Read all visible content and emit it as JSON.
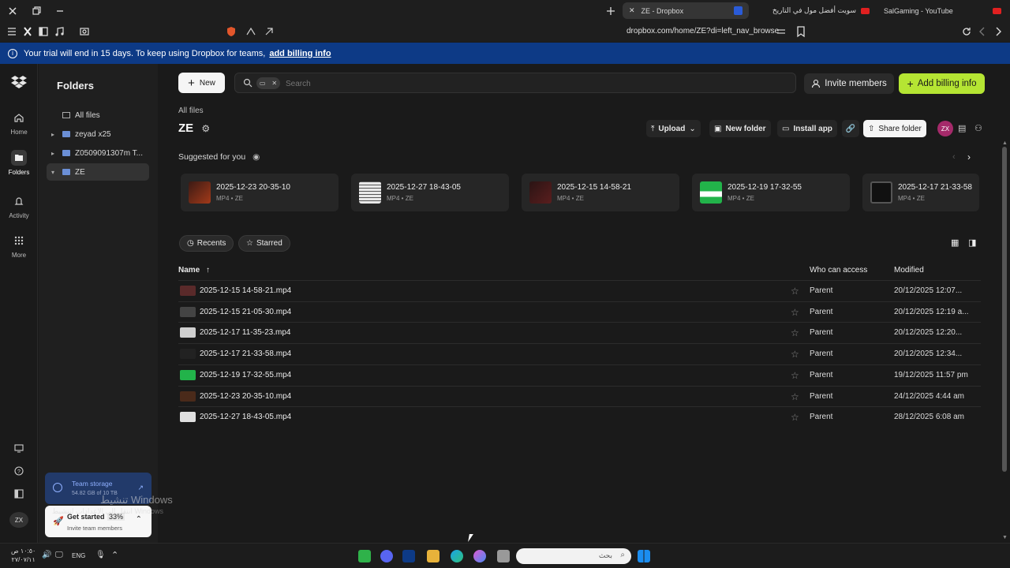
{
  "browser": {
    "tabs": [
      {
        "label": "ZE - Dropbox",
        "active": true
      },
      {
        "label": "سويت أفضل مول في التاريخ",
        "active": false
      },
      {
        "label": "SalGaming - YouTube",
        "active": false
      }
    ],
    "url": "dropbox.com/home/ZE?di=left_nav_browse"
  },
  "banner": {
    "text": "Your trial will end in 15 days. To keep using Dropbox for teams,",
    "link": "add billing info"
  },
  "rail": {
    "items": [
      {
        "label": "Home",
        "icon": "home-icon"
      },
      {
        "label": "Folders",
        "icon": "folder-icon",
        "active": true
      },
      {
        "label": "Activity",
        "icon": "bell-icon"
      },
      {
        "label": "More",
        "icon": "grid-icon"
      }
    ],
    "avatar": "ZX"
  },
  "folders": {
    "title": "Folders",
    "items": [
      {
        "label": "All files"
      },
      {
        "label": "zeyad x25"
      },
      {
        "label": "Z0509091307m T..."
      },
      {
        "label": "ZE"
      }
    ],
    "storage_title": "Team storage",
    "storage_text": "54.82 GB of 10 TB",
    "get_started": "Get started",
    "get_started_pct": "33%",
    "get_started_sub": "Invite team members"
  },
  "topbar": {
    "new_label": "New",
    "search_placeholder": "Search",
    "invite_label": "Invite members",
    "billing_label": "Add billing info"
  },
  "header": {
    "breadcrumb": "All files",
    "title": "ZE",
    "upload": "Upload",
    "new_folder": "New folder",
    "install_app": "Install app",
    "share_folder": "Share folder",
    "avatar": "ZX"
  },
  "suggested": {
    "title": "Suggested for you",
    "cards": [
      {
        "name": "2025-12-23 20-35-10",
        "meta": "MP4 • ZE",
        "color": "#3b1a14"
      },
      {
        "name": "2025-12-27 18-43-05",
        "meta": "MP4 • ZE",
        "color": "#e9e9e9"
      },
      {
        "name": "2025-12-15 14-58-21",
        "meta": "MP4 • ZE",
        "color": "#2a1414"
      },
      {
        "name": "2025-12-19 17-32-55",
        "meta": "MP4 • ZE",
        "color": "#22b34a"
      },
      {
        "name": "2025-12-17 21-33-58",
        "meta": "MP4 • ZE",
        "color": "#111111"
      }
    ]
  },
  "filters": {
    "recents": "Recents",
    "starred": "Starred"
  },
  "table": {
    "col_name": "Name",
    "col_access": "Who can access",
    "col_modified": "Modified",
    "rows": [
      {
        "name": "2025-12-15 14-58-21.mp4",
        "access": "Parent",
        "modified": "20/12/2025 12:07...",
        "color": "#5a2a2a"
      },
      {
        "name": "2025-12-15 21-05-30.mp4",
        "access": "Parent",
        "modified": "20/12/2025 12:19 a...",
        "color": "#444444"
      },
      {
        "name": "2025-12-17 11-35-23.mp4",
        "access": "Parent",
        "modified": "20/12/2025 12:20...",
        "color": "#cfcfcf"
      },
      {
        "name": "2025-12-17 21-33-58.mp4",
        "access": "Parent",
        "modified": "20/12/2025 12:34...",
        "color": "#222222"
      },
      {
        "name": "2025-12-19 17-32-55.mp4",
        "access": "Parent",
        "modified": "19/12/2025 11:57 pm",
        "color": "#22b34a"
      },
      {
        "name": "2025-12-23 20-35-10.mp4",
        "access": "Parent",
        "modified": "24/12/2025 4:44 am",
        "color": "#4a2a1a"
      },
      {
        "name": "2025-12-27 18-43-05.mp4",
        "access": "Parent",
        "modified": "28/12/2025 6:08 am",
        "color": "#e0e0e0"
      }
    ]
  },
  "watermark": {
    "line1": "تنشيط Windows",
    "line2": "انتقل إلى الإعدادات لتنشيط Windows"
  },
  "taskbar": {
    "time": "١٠:٥٠ ص",
    "date": "٢٧/٠٧/١١",
    "lang": "ENG",
    "search_placeholder": "بحث"
  },
  "colors": {
    "accent_green": "#b5e533",
    "banner_blue": "#0d3a86"
  }
}
